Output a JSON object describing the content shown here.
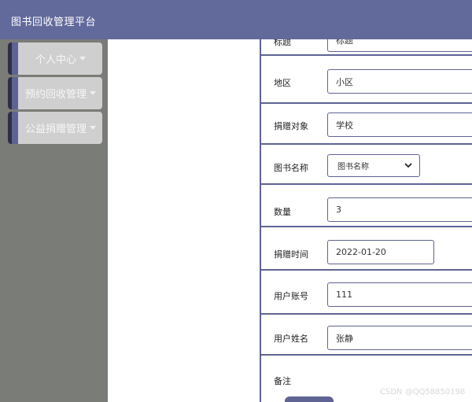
{
  "header": {
    "title": "图书回收管理平台"
  },
  "sidebar": {
    "items": [
      {
        "label": "个人中心"
      },
      {
        "label": "预约回收管理"
      },
      {
        "label": "公益捐赠管理"
      }
    ]
  },
  "form": {
    "title_field": {
      "label": "标题",
      "value": "标题"
    },
    "district": {
      "label": "地区",
      "value": "小区"
    },
    "donation_target": {
      "label": "捐赠对象",
      "value": "学校"
    },
    "book_name": {
      "label": "图书名称",
      "value": "图书名称"
    },
    "quantity": {
      "label": "数量",
      "value": "3"
    },
    "donation_time": {
      "label": "捐赠时间",
      "value": "2022-01-20"
    },
    "user_account": {
      "label": "用户账号",
      "value": "111"
    },
    "user_name": {
      "label": "用户姓名",
      "value": "张静"
    },
    "remarks": {
      "label": "备注"
    }
  },
  "watermark": "CSDN @QQ58850198",
  "colors": {
    "header": "#626a9c",
    "sidebar": "#7a7c78",
    "accent": "#5f6494"
  }
}
